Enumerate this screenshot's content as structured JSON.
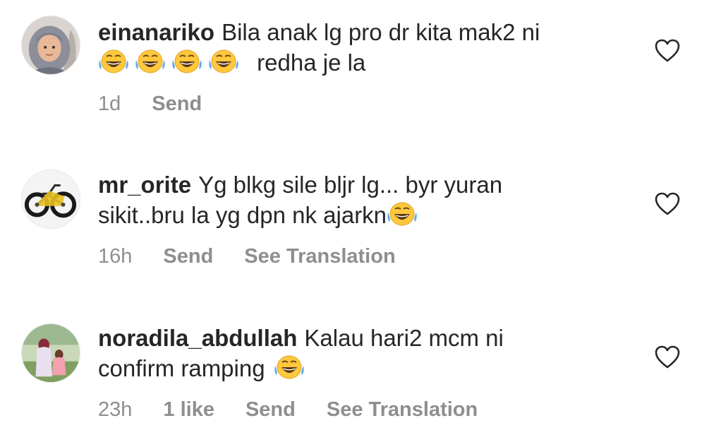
{
  "comments": [
    {
      "username": "einanariko",
      "text_line1": "Bila anak lg pro dr kita mak2 ni",
      "text_line2": "redha je la",
      "emoji_count": 4,
      "time": "1d",
      "likes": "",
      "reply_label": "Send",
      "translation_label": "",
      "avatar_icon": "woman-hijab-avatar"
    },
    {
      "username": "mr_orite",
      "text_line1": "Yg blkg sile bljr lg... byr yuran",
      "text_line2": "sikit..bru la yg dpn nk ajarkn",
      "emoji_count": 1,
      "time": "16h",
      "likes": "",
      "reply_label": "Send",
      "translation_label": "See Translation",
      "avatar_icon": "bicycle-avatar"
    },
    {
      "username": "noradila_abdullah",
      "text_line1": "Kalau hari2 mcm ni",
      "text_line2": "confirm ramping",
      "emoji_count": 1,
      "time": "23h",
      "likes": "1 like",
      "reply_label": "Send",
      "translation_label": "See Translation",
      "avatar_icon": "family-outdoor-avatar"
    }
  ],
  "emoji_name": "face-with-tears-of-joy",
  "colors": {
    "text": "#262626",
    "meta": "#8e8e8e",
    "emoji_face": "#FFC83D",
    "emoji_tear": "#5AA9F0"
  }
}
